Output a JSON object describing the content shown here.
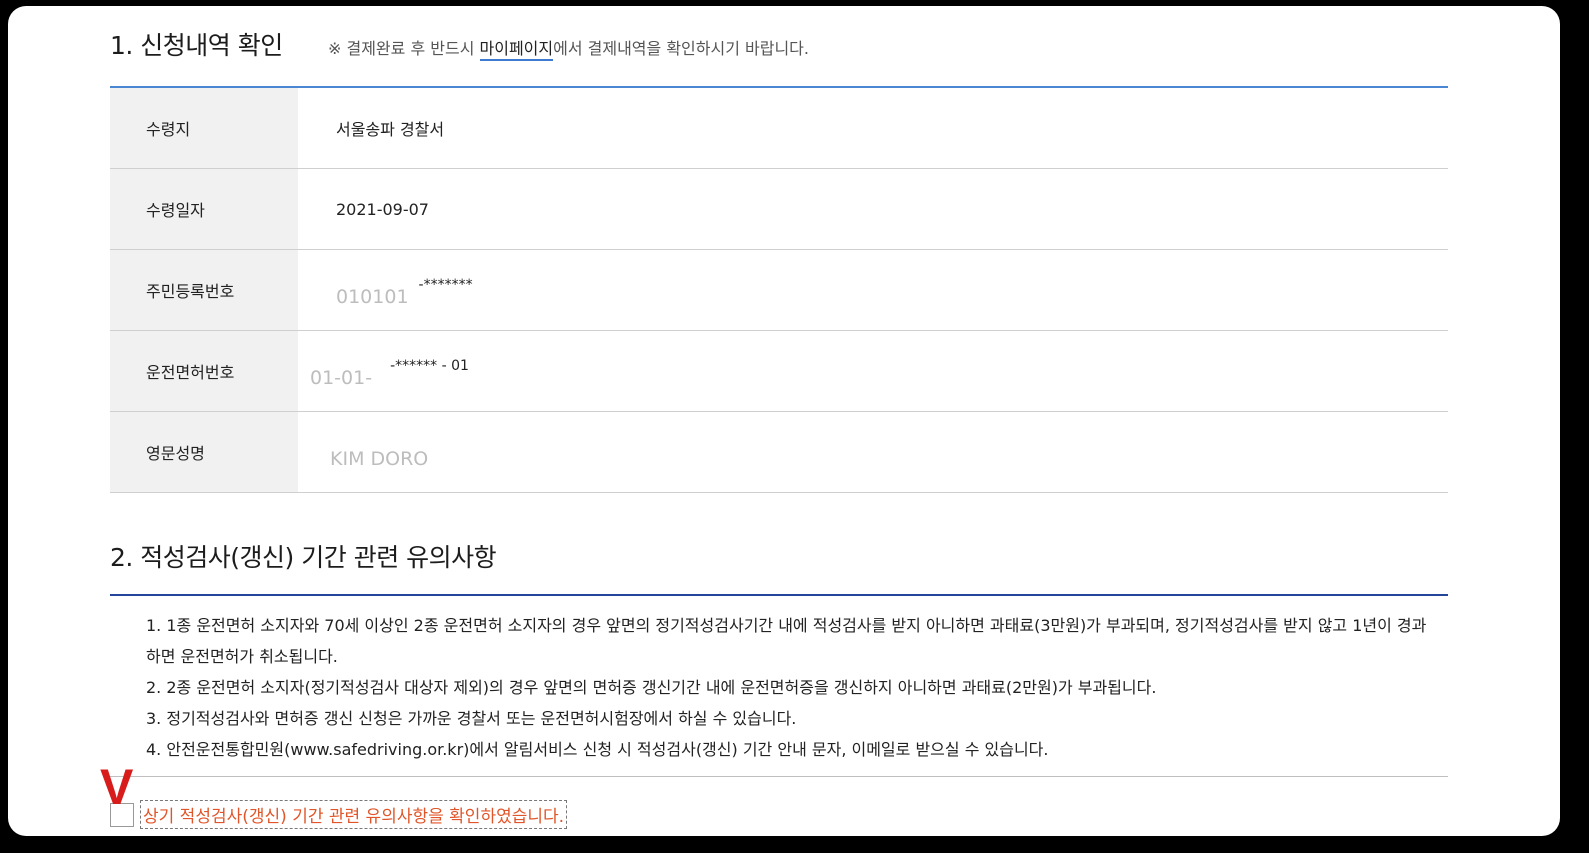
{
  "section1": {
    "title": "1. 신청내역 확인",
    "notice_prefix": "※ 결제완료 후 반드시 ",
    "notice_link": "마이페이지",
    "notice_suffix": "에서 결제내역을 확인하시기 바랍니다.",
    "rows": [
      {
        "label": "수령지",
        "value": "서울송파 경찰서"
      },
      {
        "label": "수령일자",
        "value": "2021-09-07"
      },
      {
        "label": "주민등록번호",
        "value": "010101",
        "masked": "-*******"
      },
      {
        "label": "운전면허번호",
        "value": "01-01-",
        "masked": "-****** - 01"
      },
      {
        "label": "영문성명",
        "value": "KIM DORO"
      }
    ]
  },
  "section2": {
    "title": "2. 적성검사(갱신) 기간 관련 유의사항",
    "notes": [
      "1. 1종 운전면허 소지자와 70세 이상인 2종 운전면허 소지자의 경우 앞면의 정기적성검사기간 내에 적성검사를 받지 아니하면 과태료(3만원)가 부과되며, 정기적성검사를 받지 않고 1년이 경과하면 운전면허가 취소됩니다.",
      "2. 2종 운전면허 소지자(정기적성검사 대상자 제외)의 경우 앞면의 면허증 갱신기간 내에 운전면허증을 갱신하지 아니하면 과태료(2만원)가 부과됩니다.",
      "3. 정기적성검사와 면허증 갱신 신청은 가까운 경찰서 또는 운전면허시험장에서 하실 수 있습니다.",
      "4. 안전운전통합민원(www.safedriving.or.kr)에서 알림서비스 신청 시 적성검사(갱신) 기간 안내 문자, 이메일로 받으실 수 있습니다."
    ],
    "confirm_label": "상기 적성검사(갱신) 기간 관련 유의사항을 확인하였습니다.",
    "check_annotation": "V"
  },
  "colors": {
    "accent_blue": "#4a86d2",
    "navy": "#23469b",
    "confirm_text": "#e0562a",
    "annotation_red": "#d81c1c"
  }
}
